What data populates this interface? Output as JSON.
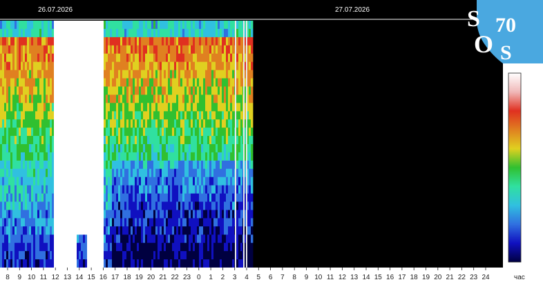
{
  "chart_data": {
    "type": "heatmap",
    "title": "",
    "dates": [
      "26.07.2026",
      "27.07.2026"
    ],
    "x_tick_labels": [
      "8",
      "9",
      "10",
      "11",
      "12",
      "13",
      "14",
      "15",
      "16",
      "17",
      "18",
      "19",
      "20",
      "21",
      "22",
      "23",
      "0",
      "1",
      "2",
      "3",
      "4",
      "5",
      "6",
      "7",
      "8",
      "9",
      "10",
      "11",
      "12",
      "13",
      "14",
      "15",
      "16",
      "17",
      "18",
      "19",
      "20",
      "21",
      "22",
      "23",
      "24"
    ],
    "x_unit": "час",
    "data_start_hour_index": 0,
    "data_end_tick_index": 20.5,
    "colorbar_colors": [
      "#ffffff",
      "#f0b8b8",
      "#e03020",
      "#e08020",
      "#e0d020",
      "#30c030",
      "#30e0a0",
      "#30c0e0",
      "#3070e0",
      "#1010c0",
      "#000040"
    ],
    "colorbar_label": "",
    "grid": false
  },
  "logo": {
    "letters": [
      "S",
      "O",
      "S"
    ],
    "digits": "70",
    "background_color": "#4aa8e0"
  },
  "colors": {
    "plot_background": "#000000",
    "axis_text": "#ffffff",
    "outer_text": "#1a1a1a"
  }
}
